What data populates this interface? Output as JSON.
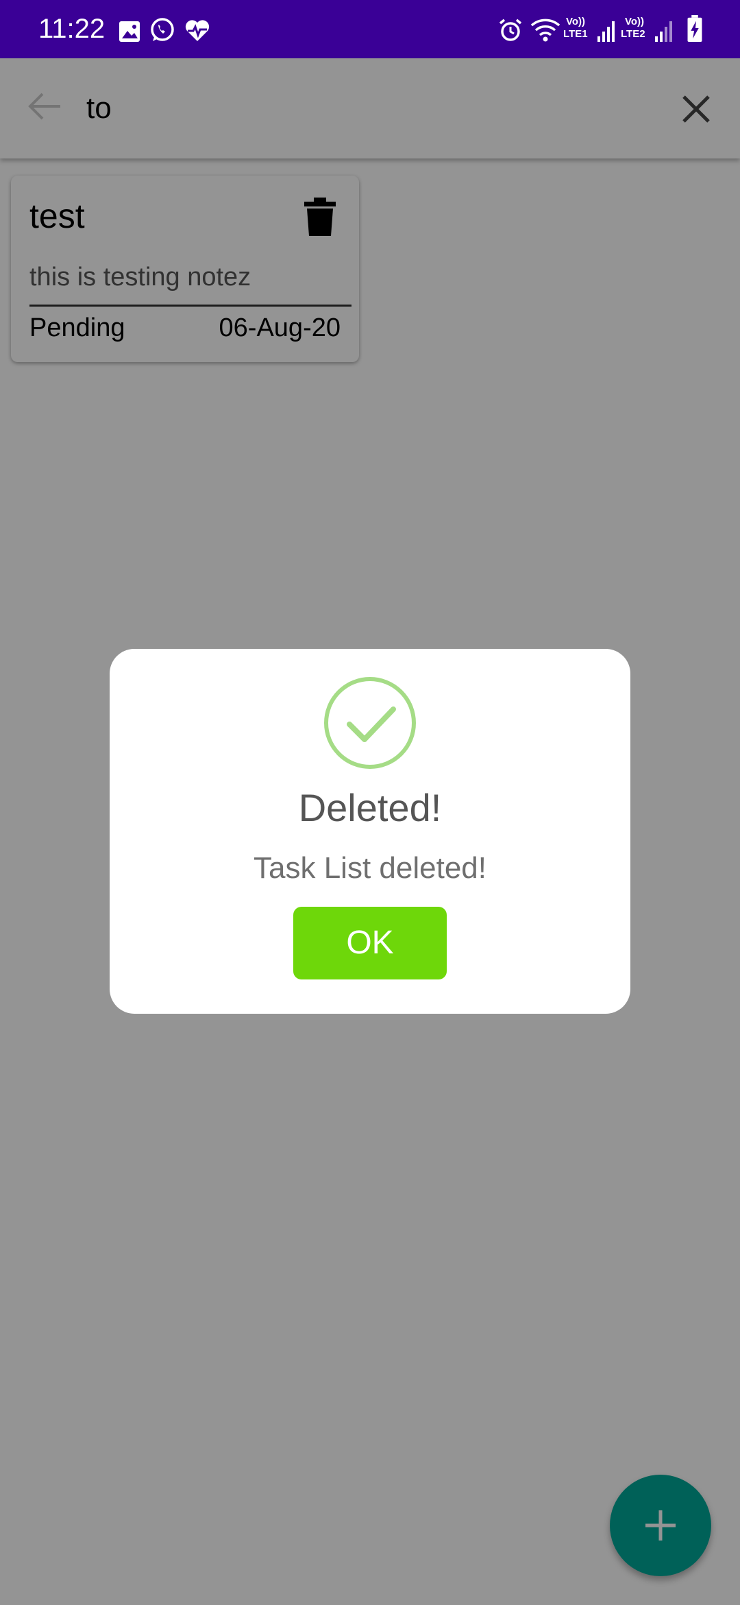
{
  "status_bar": {
    "time": "11:22",
    "icons_left": [
      "image-icon",
      "whatsapp-icon",
      "health-heart-icon"
    ],
    "icons_right": [
      "alarm-icon",
      "wifi-icon",
      "signal-lte1-icon",
      "signal-lte2-icon",
      "battery-charging-icon"
    ],
    "sim1_top": "Vo))",
    "sim1_bottom": "LTE1",
    "sim2_top": "Vo))",
    "sim2_bottom": "LTE2",
    "background": "#3a0096"
  },
  "search": {
    "value": "to",
    "back_icon": "arrow-back-icon",
    "clear_icon": "close-icon"
  },
  "tasks": [
    {
      "title": "test",
      "description": "this is testing notez",
      "status": "Pending",
      "date": "06-Aug-20",
      "delete_icon": "trash-icon"
    }
  ],
  "dialog": {
    "icon": "success-check-icon",
    "title": "Deleted!",
    "message": "Task List deleted!",
    "ok_label": "OK",
    "ok_color": "#6ed70a",
    "icon_color": "#a5dc86"
  },
  "fab": {
    "icon": "plus-icon",
    "color": "#00a898"
  }
}
